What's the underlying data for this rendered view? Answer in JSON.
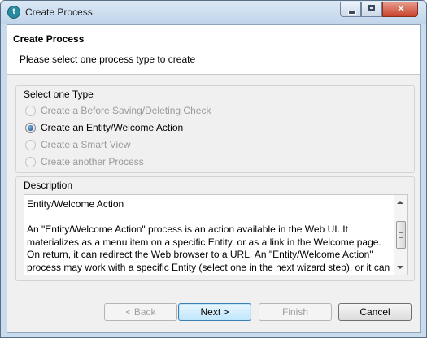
{
  "window": {
    "title": "Create Process",
    "app_icon": "talend-icon",
    "controls": [
      "minimize-icon",
      "maximize-icon",
      "close-icon"
    ]
  },
  "banner": {
    "title": "Create Process",
    "subtitle": "Please select one process type to create"
  },
  "type_group": {
    "label": "Select one Type",
    "options": [
      {
        "label": "Create a Before Saving/Deleting Check",
        "enabled": false,
        "selected": false
      },
      {
        "label": "Create an Entity/Welcome Action",
        "enabled": true,
        "selected": true
      },
      {
        "label": "Create a Smart View",
        "enabled": false,
        "selected": false
      },
      {
        "label": "Create another Process",
        "enabled": false,
        "selected": false
      }
    ]
  },
  "description": {
    "label": "Description",
    "heading": "Entity/Welcome Action",
    "body": "An \"Entity/Welcome Action\" process is an action available in the Web UI. It materializes as a menu item on a specific Entity, or as a link in the Welcome page. On return, it can redirect the Web browser to a URL. An \"Entity/Welcome Action\" process may work with a specific Entity (select one in the next wizard step), or it can be a"
  },
  "buttons": {
    "back": {
      "label": "< Back",
      "enabled": false
    },
    "next": {
      "label": "Next >",
      "enabled": true
    },
    "finish": {
      "label": "Finish",
      "enabled": false
    },
    "cancel": {
      "label": "Cancel",
      "enabled": true
    }
  }
}
